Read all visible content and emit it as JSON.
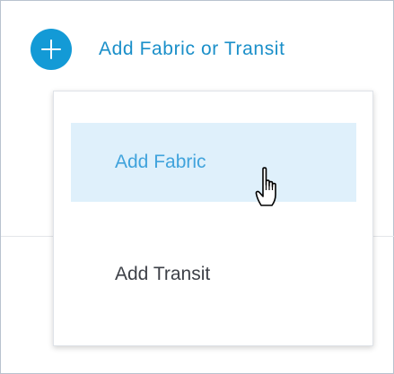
{
  "toolbar": {
    "add_label": "Add Fabric or Transit",
    "add_icon": "plus-circle-icon",
    "accent_color": "#139ad6"
  },
  "menu": {
    "items": [
      {
        "label": "Add Fabric",
        "state": "hovered"
      },
      {
        "label": "Add Transit",
        "state": "normal"
      }
    ],
    "hover_bg_color": "#dff0fb",
    "hover_text_color": "#40a3dc"
  },
  "cursor": {
    "icon": "hand-pointer-icon"
  }
}
